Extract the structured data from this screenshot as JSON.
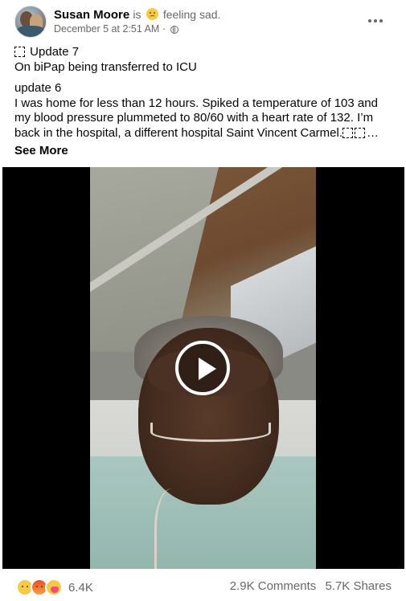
{
  "post": {
    "author": "Susan Moore",
    "is_text": "is",
    "feeling": "feeling sad.",
    "timestamp": "December 5 at 2:51 AM",
    "separator": "·",
    "update7_title": "Update 7",
    "update7_body": "On biPap being transferred to ICU",
    "update6_title": "update 6",
    "update6_body": "I was home for less than 12 hours. Spiked a temperature of 103 and my blood pressure plummeted to 80/60 with a heart rate of 132. I’m back in the hospital, a different hospital Saint Vincent Carmel.",
    "ellipsis": "…",
    "see_more": "See More"
  },
  "icons": {
    "avatar": "profile-photo",
    "feeling_emoji": "sad-face-emoji",
    "privacy": "globe-icon",
    "more": "more-options-icon",
    "play": "play-icon",
    "reactions": [
      "sad-reaction",
      "angry-reaction",
      "care-reaction"
    ]
  },
  "footer": {
    "reaction_count": "6.4K",
    "comments": "2.9K Comments",
    "shares": "5.7K Shares"
  },
  "colors": {
    "secondary_text": "#65676b",
    "primary_text": "#050505",
    "video_bg": "#000000"
  }
}
